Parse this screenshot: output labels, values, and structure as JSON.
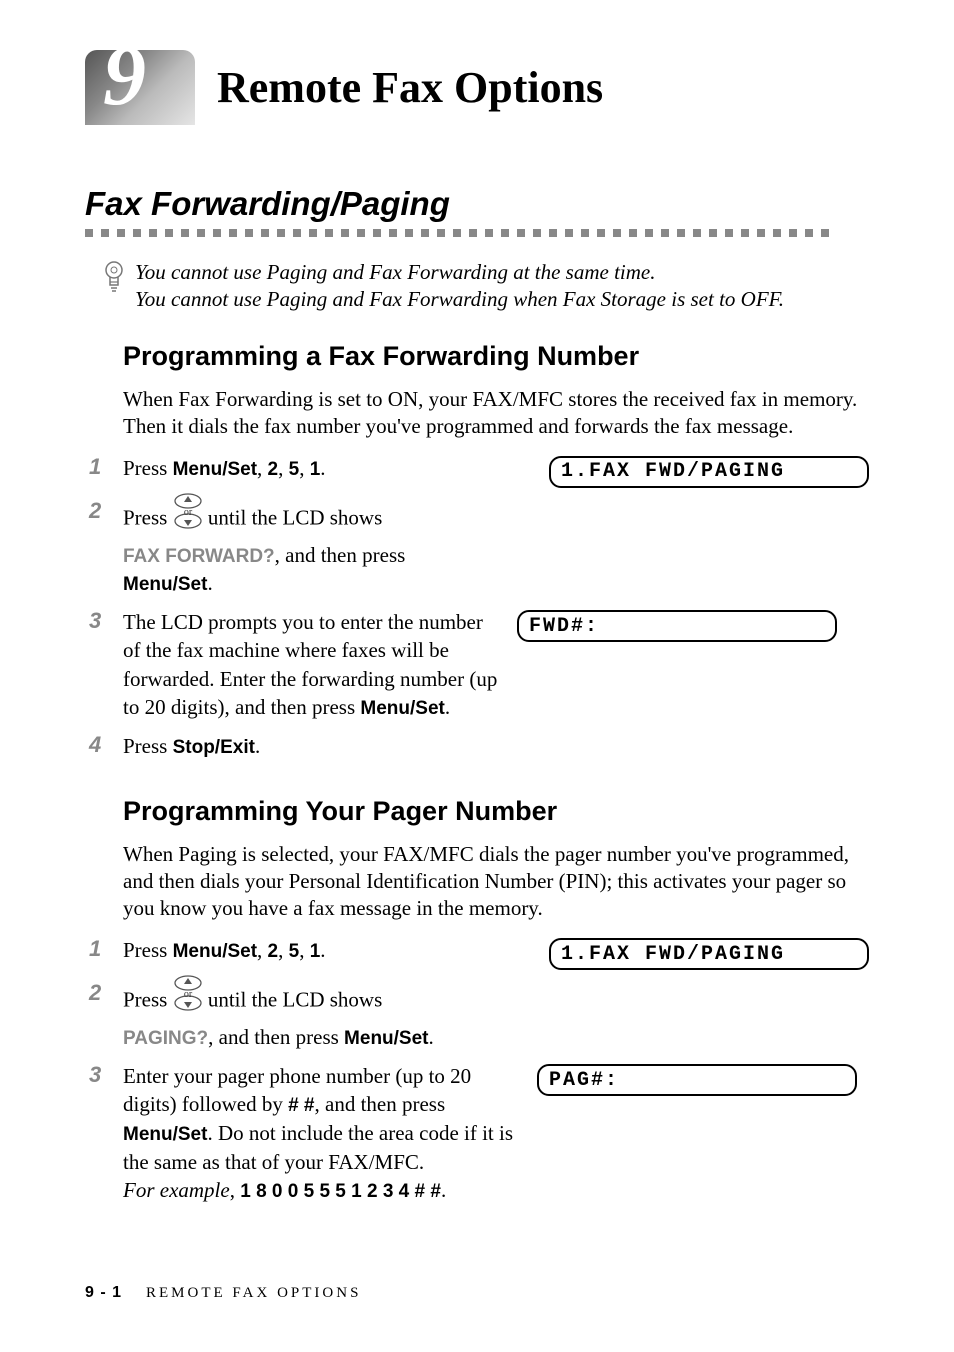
{
  "chapter": {
    "number": "9",
    "title": "Remote Fax Options"
  },
  "section1": {
    "title": "Fax Forwarding/Paging",
    "note_line1": "You cannot use Paging and Fax Forwarding at the same time.",
    "note_line2": "You cannot use Paging and Fax Forwarding when Fax Storage is set to OFF."
  },
  "sub1": {
    "title": "Programming a Fax Forwarding Number",
    "intro": "When Fax Forwarding is set to ON, your FAX/MFC stores the received fax in memory. Then it dials the fax number you've programmed and forwards the fax message.",
    "steps": {
      "s1_a": "Press ",
      "s1_b": "Menu/Set",
      "s1_c": ", ",
      "s1_d": "2",
      "s1_e": ", ",
      "s1_f": "5",
      "s1_g": ", ",
      "s1_h": "1",
      "s1_i": ".",
      "lcd1": "1.FAX FWD/PAGING",
      "s2_a": "Press ",
      "s2_b": " until the LCD shows ",
      "s2_c": "FAX FORWARD?",
      "s2_d": ", and then press ",
      "s2_e": "Menu/Set",
      "s2_f": ".",
      "s3_a": "The LCD prompts you to enter the number of the fax machine where faxes will be forwarded. Enter the forwarding number (up to 20 digits), and then press ",
      "s3_b": "Menu/Set",
      "s3_c": ".",
      "lcd3": "FWD#:",
      "s4_a": "Press ",
      "s4_b": "Stop/Exit",
      "s4_c": "."
    }
  },
  "sub2": {
    "title": "Programming Your Pager Number",
    "intro": "When Paging is selected, your FAX/MFC dials the pager number you've programmed, and then dials your Personal Identification Number (PIN); this activates your pager so you know you have a fax message in the memory.",
    "steps": {
      "s1_a": "Press ",
      "s1_b": "Menu/Set",
      "s1_c": ", ",
      "s1_d": "2",
      "s1_e": ", ",
      "s1_f": "5",
      "s1_g": ", ",
      "s1_h": "1",
      "s1_i": ".",
      "lcd1": "1.FAX FWD/PAGING",
      "s2_a": "Press ",
      "s2_b": " until the LCD shows ",
      "s2_c": "PAGING?",
      "s2_d": ", and then press ",
      "s2_e": "Menu/Set",
      "s2_f": ".",
      "s3_a": "Enter your pager phone number (up to 20 digits) followed by ",
      "s3_b": "# #",
      "s3_c": ", and then press ",
      "s3_d": "Menu/Set",
      "s3_e": ". Do not include the area code if it is the same as that of your FAX/MFC.",
      "s3_f": "For example",
      "s3_g": ", ",
      "s3_h": "1 8 0 0 5 5 5 1 2 3 4 # #",
      "s3_i": ".",
      "lcd3": "PAG#:"
    }
  },
  "footer": {
    "page": "9 - 1",
    "section": "REMOTE FAX OPTIONS"
  }
}
